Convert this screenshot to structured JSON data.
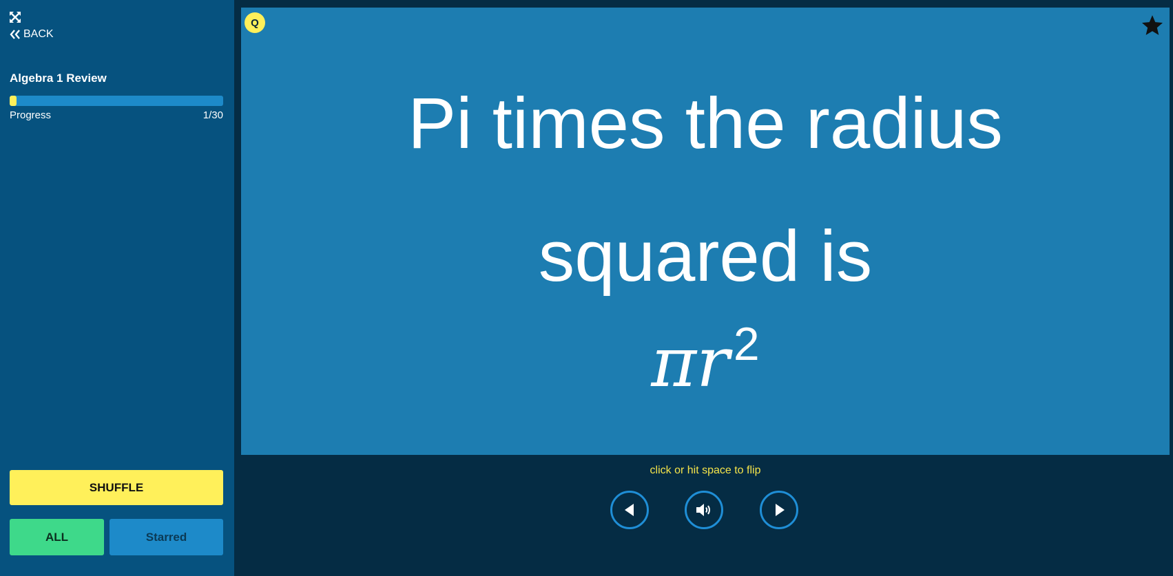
{
  "sidebar": {
    "back_label": "BACK",
    "deck_title": "Algebra 1 Review",
    "progress": {
      "label": "Progress",
      "count": "1/30",
      "current": 1,
      "total": 30
    },
    "shuffle_label": "SHUFFLE",
    "filter_all_label": "ALL",
    "filter_starred_label": "Starred"
  },
  "card": {
    "side_badge": "Q",
    "lines": [
      "Pi times the radius",
      "squared is"
    ],
    "formula_symbols": "πr",
    "formula_exponent": "2"
  },
  "controls": {
    "flip_hint": "click or hit space to flip"
  },
  "colors": {
    "sidebar_bg": "#06527f",
    "page_bg": "#052c44",
    "card_bg": "#1d7db1",
    "accent_yellow": "#fff05a",
    "accent_green": "#3ed98a",
    "accent_blue": "#1d8ac9"
  },
  "icons": {
    "expand": "expand-icon",
    "back": "double-chevron-left-icon",
    "star": "star-icon",
    "prev": "triangle-left-icon",
    "audio": "speaker-icon",
    "next": "triangle-right-icon"
  }
}
